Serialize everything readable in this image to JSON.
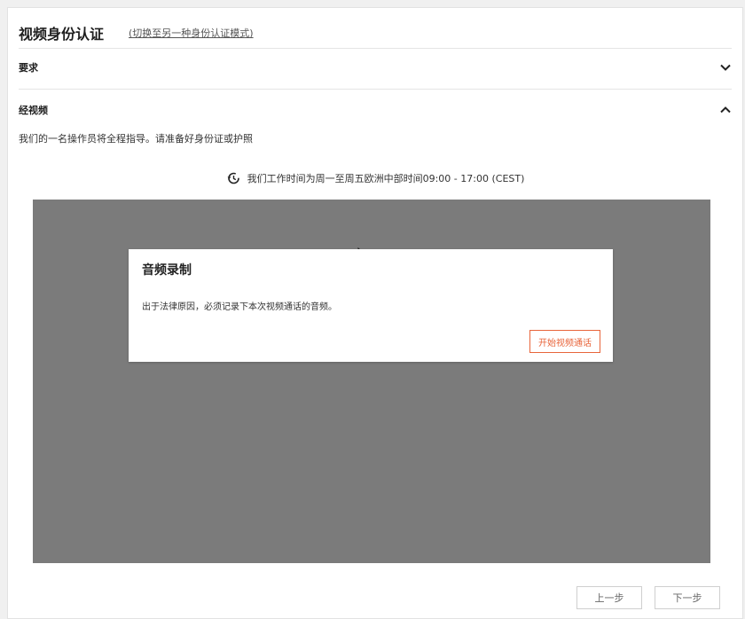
{
  "header": {
    "title": "视频身份认证",
    "switch_link": "(切换至另一种身份认证模式)"
  },
  "sections": {
    "requirements": {
      "label": "要求",
      "icon": "chevron-down-icon"
    },
    "video": {
      "label": "经视频",
      "icon": "chevron-up-icon"
    }
  },
  "instruction": "我们的一名操作员将全程指导。请准备好身份证或护照",
  "hours": {
    "icon": "clock-history-icon",
    "text": "我们工作时间为周一至周五欧洲中部时间09:00 - 17:00 (CEST)"
  },
  "dialog": {
    "title": "音频录制",
    "text": "出于法律原因，必须记录下本次视频通话的音频。",
    "button": "开始视频通话"
  },
  "footer": {
    "prev": "上一步",
    "next": "下一步"
  },
  "colors": {
    "accent": "#e8653b",
    "video_bg": "#7b7b7b"
  }
}
